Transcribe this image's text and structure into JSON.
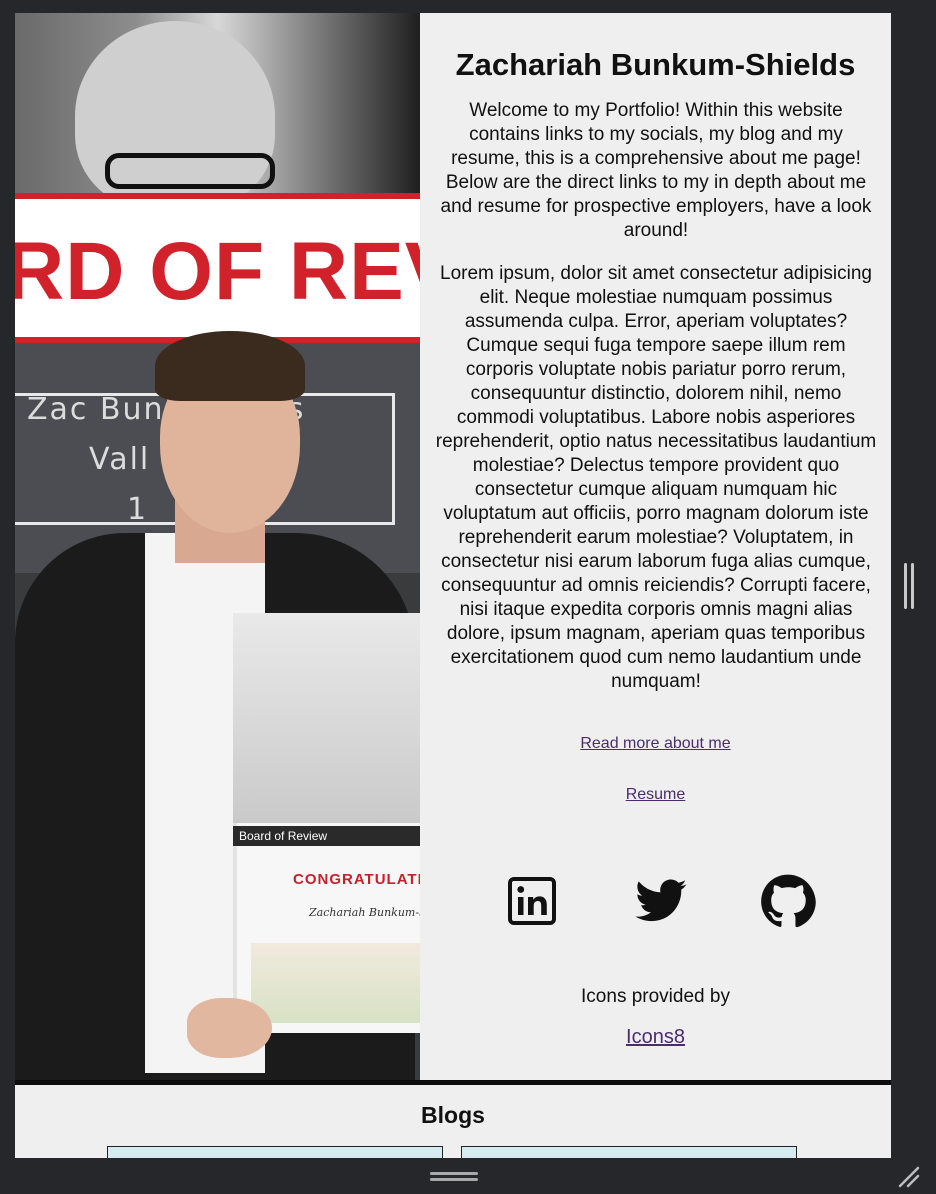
{
  "profile": {
    "name": "Zachariah Bunkum-Shields",
    "intro": "Welcome to my Portfolio! Within this website contains links to my socials, my blog and my resume, this is a comprehensive about me page! Below are the direct links to my in depth about me and resume for prospective employers, have a look around!",
    "bio": "Lorem ipsum, dolor sit amet consectetur adipisicing elit. Neque molestiae numquam possimus assumenda culpa. Error, aperiam voluptates? Cumque sequi fuga tempore saepe illum rem corporis voluptate nobis pariatur porro rerum, consequuntur distinctio, dolorem nihil, nemo commodi voluptatibus. Labore nobis asperiores reprehenderit, optio natus necessitatibus laudantium molestiae? Delectus tempore provident quo consectetur cumque aliquam numquam hic voluptatum aut officiis, porro magnam dolorum iste reprehenderit earum molestiae? Voluptatem, in consectetur nisi earum laborum fuga alias cumque, consequuntur ad omnis reiciendis? Corrupti facere, nisi itaque expedita corporis omnis magni alias dolore, ipsum magnam, aperiam quas temporibus exercitationem quod cum nemo laudantium unde numquam!"
  },
  "photo": {
    "banner_text": "RD OF REVIE",
    "name_line1": "Zac Bunk         s",
    "name_line2": "Vall",
    "name_line3": "1",
    "cert_header": "Board of Review",
    "cert_title": "CONGRATULATIO",
    "cert_name": "Zachariah Bunkum-Shie"
  },
  "links": {
    "about": "Read more about me",
    "resume": "Resume"
  },
  "socials": [
    {
      "name": "linkedin",
      "icon": "linkedin-icon"
    },
    {
      "name": "twitter",
      "icon": "twitter-icon"
    },
    {
      "name": "github",
      "icon": "github-icon"
    }
  ],
  "credits": {
    "text": "Icons provided by",
    "link": "Icons8"
  },
  "blogs": {
    "title": "Blogs"
  },
  "colors": {
    "background": "#efefef",
    "chrome": "#26272b",
    "link": "#4b2c6e",
    "blog_card": "#d4ecef",
    "banner_red": "#d1222c"
  }
}
